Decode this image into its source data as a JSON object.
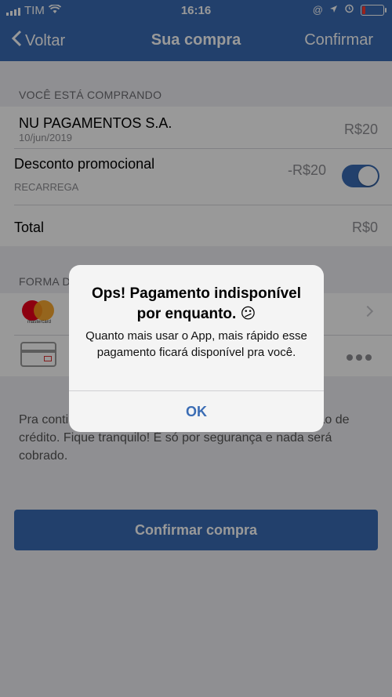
{
  "status_bar": {
    "carrier": "TIM",
    "time": "16:16",
    "icons": [
      "signal-icon",
      "wifi-icon",
      "at-icon",
      "location-icon",
      "alarm-icon",
      "battery-icon"
    ]
  },
  "nav": {
    "back_label": "Voltar",
    "title": "Sua compra",
    "confirm_label": "Confirmar"
  },
  "purchase": {
    "section_label": "VOCÊ ESTÁ COMPRANDO",
    "merchant": "NU PAGAMENTOS S.A.",
    "date": "10/jun/2019",
    "amount": "R$20",
    "discount_label": "Desconto promocional",
    "discount_sub": "RECARREGA",
    "discount_value": "-R$20",
    "discount_enabled": true,
    "total_label": "Total",
    "total_value": "R$0"
  },
  "payment": {
    "section_label": "FORMA D",
    "mastercard_label": "mastercard"
  },
  "info_text": "Pra continuar, precisamos que você cadastre seu cartão de crédito. Fique tranquilo! É só por segurança e nada será cobrado.",
  "cta_label": "Confirmar compra",
  "alert": {
    "title": "Ops! Pagamento indisponível por enquanto. 😕",
    "message": "Quanto mais usar o App, mais rápido esse pagamento ficará disponível pra você.",
    "button": "OK"
  },
  "colors": {
    "brand_blue": "#3a6cb4",
    "background": "#efeff4"
  }
}
